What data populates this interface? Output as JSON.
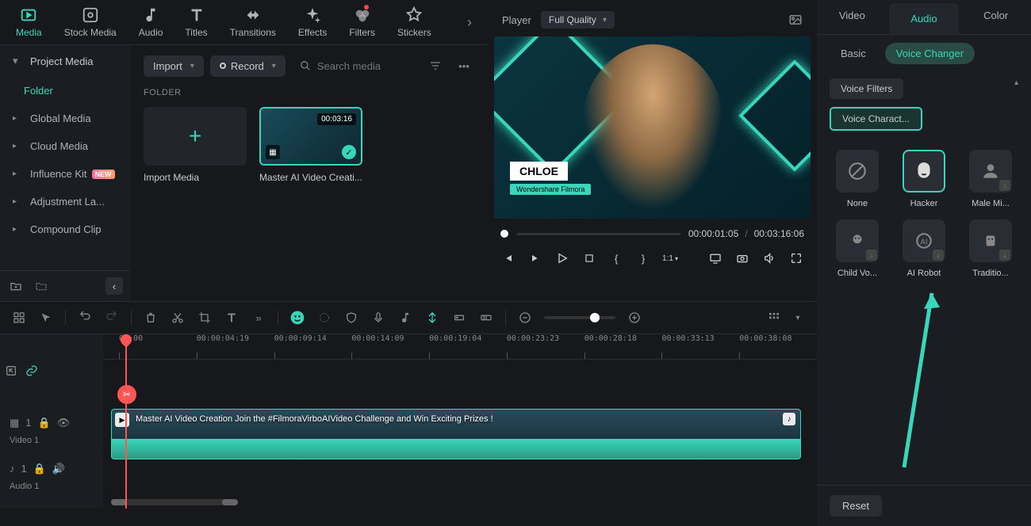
{
  "toolbar": {
    "items": [
      {
        "label": "Media",
        "icon": "media"
      },
      {
        "label": "Stock Media",
        "icon": "stock"
      },
      {
        "label": "Audio",
        "icon": "audio"
      },
      {
        "label": "Titles",
        "icon": "titles"
      },
      {
        "label": "Transitions",
        "icon": "transitions"
      },
      {
        "label": "Effects",
        "icon": "effects"
      },
      {
        "label": "Filters",
        "icon": "filters"
      },
      {
        "label": "Stickers",
        "icon": "stickers"
      }
    ]
  },
  "sidebar": {
    "project_media": "Project Media",
    "folder": "Folder",
    "items": [
      "Global Media",
      "Cloud Media",
      "Influence Kit",
      "Adjustment La...",
      "Compound Clip"
    ]
  },
  "media": {
    "import_btn": "Import",
    "record_btn": "Record",
    "search_placeholder": "Search media",
    "folder_label": "FOLDER",
    "import_card": "Import Media",
    "clip": {
      "duration": "00:03:16",
      "title": "Master AI Video Creati..."
    }
  },
  "preview": {
    "title": "Player",
    "quality": "Full Quality",
    "name_overlay": "CHLOE",
    "brand_overlay": "Wondershare Filmora",
    "time_current": "00:00:01:05",
    "time_total": "00:03:16:06"
  },
  "right": {
    "tabs": [
      "Video",
      "Audio",
      "Color"
    ],
    "sub_tabs": [
      "Basic",
      "Voice Changer"
    ],
    "voice_filters": "Voice Filters",
    "voice_character": "Voice Charact...",
    "voices": [
      "None",
      "Hacker",
      "Male Mi...",
      "Child Vo...",
      "AI Robot",
      "Traditio..."
    ],
    "reset": "Reset"
  },
  "timeline": {
    "ruler": [
      "00:00",
      "00:00:04:19",
      "00:00:09:14",
      "00:00:14:09",
      "00:00:19:04",
      "00:00:23:23",
      "00:00:28:18",
      "00:00:33:13",
      "00:00:38:08"
    ],
    "video_track": "Video 1",
    "audio_track": "Audio 1",
    "clip_title": "Master AI Video Creation   Join the #FilmoraVirboAIVideo Challenge and Win Exciting Prizes !",
    "track_badge": "1"
  }
}
